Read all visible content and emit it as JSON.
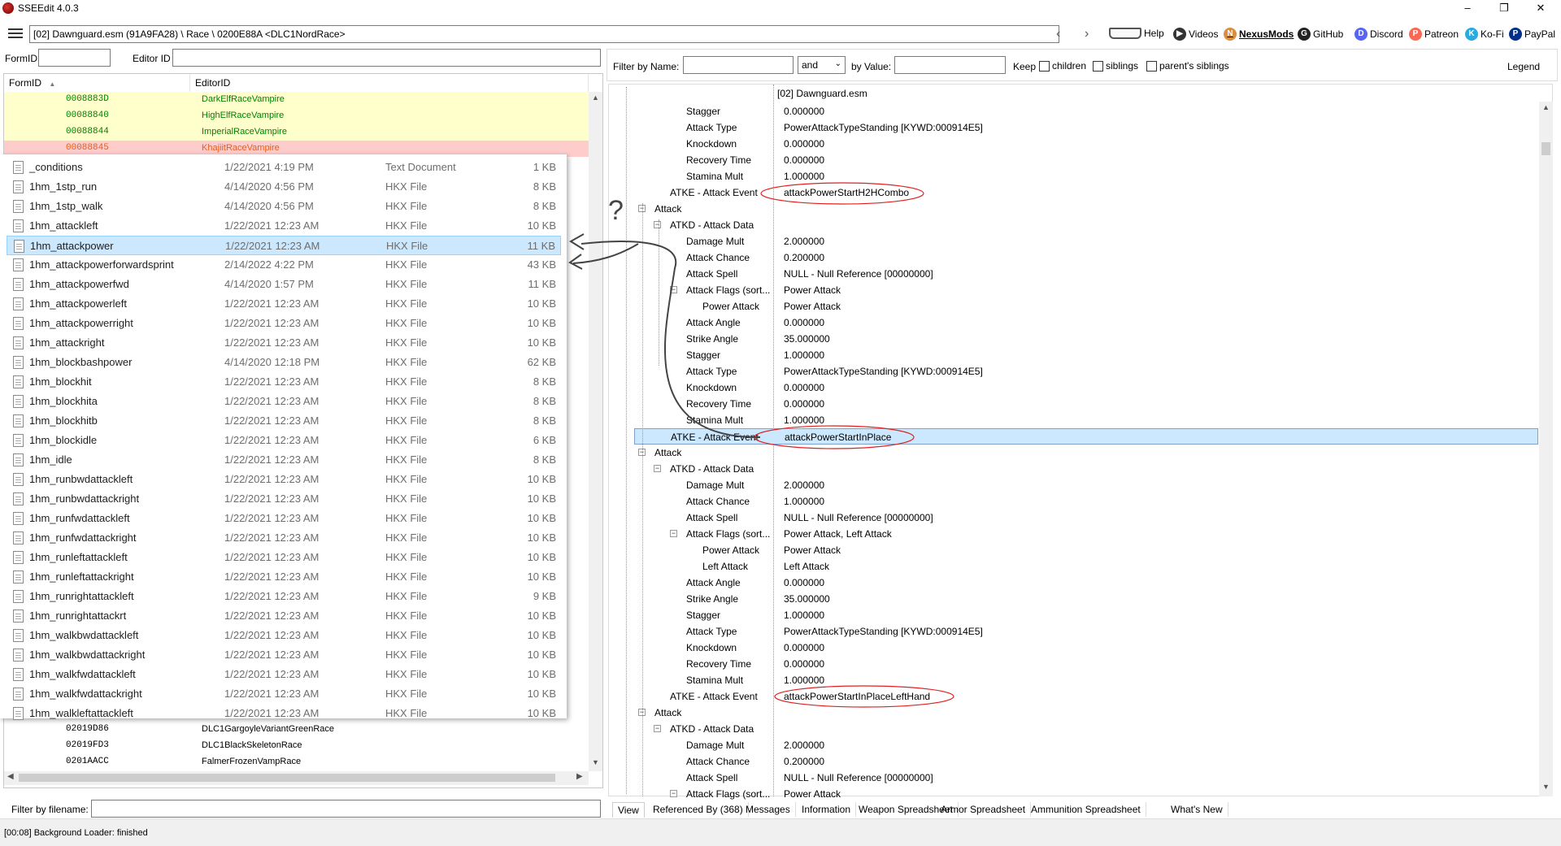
{
  "window": {
    "title": "SSEEdit 4.0.3",
    "minimize": "–",
    "maximize": "❐",
    "close": "✕"
  },
  "toolbar": {
    "path": "[02] Dawnguard.esm (91A9FA28) \\ Race \\ 0200E88A <DLC1NordRace>",
    "back": "‹",
    "forward": "›",
    "links": [
      "Help",
      "Videos",
      "NexusMods",
      "GitHub",
      "Discord",
      "Patreon",
      "Ko-Fi",
      "PayPal"
    ]
  },
  "left": {
    "formid_label": "FormID",
    "editorid_label": "Editor ID",
    "col_formid": "FormID",
    "col_editorid": "EditorID",
    "top_rows": [
      {
        "formid": "0008883D",
        "editorid": "DarkElfRaceVampire",
        "state": "yellow"
      },
      {
        "formid": "00088840",
        "editorid": "HighElfRaceVampire",
        "state": "yellow"
      },
      {
        "formid": "00088844",
        "editorid": "ImperialRaceVampire",
        "state": "yellow"
      },
      {
        "formid": "00088845",
        "editorid": "KhajiitRaceVampire",
        "state": "red"
      }
    ],
    "bottom_rows": [
      {
        "formid": "02019D86",
        "editorid": "DLC1GargoyleVariantGreenRace"
      },
      {
        "formid": "02019FD3",
        "editorid": "DLC1BlackSkeletonRace"
      },
      {
        "formid": "0201AACC",
        "editorid": "FalmerFrozenVampRace"
      }
    ],
    "filter_label": "Filter by filename:"
  },
  "explorer": {
    "files": [
      {
        "name": "_conditions",
        "date": "1/22/2021 4:19 PM",
        "type": "Text Document",
        "size": "1 KB"
      },
      {
        "name": "1hm_1stp_run",
        "date": "4/14/2020 4:56 PM",
        "type": "HKX File",
        "size": "8 KB"
      },
      {
        "name": "1hm_1stp_walk",
        "date": "4/14/2020 4:56 PM",
        "type": "HKX File",
        "size": "8 KB"
      },
      {
        "name": "1hm_attackleft",
        "date": "1/22/2021 12:23 AM",
        "type": "HKX File",
        "size": "10 KB"
      },
      {
        "name": "1hm_attackpower",
        "date": "1/22/2021 12:23 AM",
        "type": "HKX File",
        "size": "11 KB"
      },
      {
        "name": "1hm_attackpowerforwardsprint",
        "date": "2/14/2022 4:22 PM",
        "type": "HKX File",
        "size": "43 KB"
      },
      {
        "name": "1hm_attackpowerfwd",
        "date": "4/14/2020 1:57 PM",
        "type": "HKX File",
        "size": "11 KB"
      },
      {
        "name": "1hm_attackpowerleft",
        "date": "1/22/2021 12:23 AM",
        "type": "HKX File",
        "size": "10 KB"
      },
      {
        "name": "1hm_attackpowerright",
        "date": "1/22/2021 12:23 AM",
        "type": "HKX File",
        "size": "10 KB"
      },
      {
        "name": "1hm_attackright",
        "date": "1/22/2021 12:23 AM",
        "type": "HKX File",
        "size": "10 KB"
      },
      {
        "name": "1hm_blockbashpower",
        "date": "4/14/2020 12:18 PM",
        "type": "HKX File",
        "size": "62 KB"
      },
      {
        "name": "1hm_blockhit",
        "date": "1/22/2021 12:23 AM",
        "type": "HKX File",
        "size": "8 KB"
      },
      {
        "name": "1hm_blockhita",
        "date": "1/22/2021 12:23 AM",
        "type": "HKX File",
        "size": "8 KB"
      },
      {
        "name": "1hm_blockhitb",
        "date": "1/22/2021 12:23 AM",
        "type": "HKX File",
        "size": "8 KB"
      },
      {
        "name": "1hm_blockidle",
        "date": "1/22/2021 12:23 AM",
        "type": "HKX File",
        "size": "6 KB"
      },
      {
        "name": "1hm_idle",
        "date": "1/22/2021 12:23 AM",
        "type": "HKX File",
        "size": "8 KB"
      },
      {
        "name": "1hm_runbwdattackleft",
        "date": "1/22/2021 12:23 AM",
        "type": "HKX File",
        "size": "10 KB"
      },
      {
        "name": "1hm_runbwdattackright",
        "date": "1/22/2021 12:23 AM",
        "type": "HKX File",
        "size": "10 KB"
      },
      {
        "name": "1hm_runfwdattackleft",
        "date": "1/22/2021 12:23 AM",
        "type": "HKX File",
        "size": "10 KB"
      },
      {
        "name": "1hm_runfwdattackright",
        "date": "1/22/2021 12:23 AM",
        "type": "HKX File",
        "size": "10 KB"
      },
      {
        "name": "1hm_runleftattackleft",
        "date": "1/22/2021 12:23 AM",
        "type": "HKX File",
        "size": "10 KB"
      },
      {
        "name": "1hm_runleftattackright",
        "date": "1/22/2021 12:23 AM",
        "type": "HKX File",
        "size": "10 KB"
      },
      {
        "name": "1hm_runrightattackleft",
        "date": "1/22/2021 12:23 AM",
        "type": "HKX File",
        "size": "9 KB"
      },
      {
        "name": "1hm_runrightattackrt",
        "date": "1/22/2021 12:23 AM",
        "type": "HKX File",
        "size": "10 KB"
      },
      {
        "name": "1hm_walkbwdattackleft",
        "date": "1/22/2021 12:23 AM",
        "type": "HKX File",
        "size": "10 KB"
      },
      {
        "name": "1hm_walkbwdattackright",
        "date": "1/22/2021 12:23 AM",
        "type": "HKX File",
        "size": "10 KB"
      },
      {
        "name": "1hm_walkfwdattackleft",
        "date": "1/22/2021 12:23 AM",
        "type": "HKX File",
        "size": "10 KB"
      },
      {
        "name": "1hm_walkfwdattackright",
        "date": "1/22/2021 12:23 AM",
        "type": "HKX File",
        "size": "10 KB"
      },
      {
        "name": "1hm_walkleftattackleft",
        "date": "1/22/2021 12:23 AM",
        "type": "HKX File",
        "size": "10 KB"
      }
    ],
    "selected": 4
  },
  "annotation": {
    "question": "?"
  },
  "right": {
    "filter_name_label": "Filter by Name:",
    "and_select": "and",
    "by_value_label": "by Value:",
    "keep_label": "Keep",
    "children": "children",
    "siblings": "siblings",
    "parents_siblings": "parent's siblings",
    "legend": "Legend",
    "column_header": "[02] Dawnguard.esm",
    "rows": [
      {
        "label": "Stagger",
        "value": "0.000000",
        "indent": 3
      },
      {
        "label": "Attack Type",
        "value": "PowerAttackTypeStanding [KYWD:000914E5]",
        "indent": 3
      },
      {
        "label": "Knockdown",
        "value": "0.000000",
        "indent": 3
      },
      {
        "label": "Recovery Time",
        "value": "0.000000",
        "indent": 3
      },
      {
        "label": "Stamina Mult",
        "value": "1.000000",
        "indent": 3
      },
      {
        "label": "ATKE - Attack Event",
        "value": "attackPowerStartH2HCombo",
        "indent": 2,
        "circle": true
      },
      {
        "label": "Attack",
        "value": "",
        "indent": 1,
        "expander": true
      },
      {
        "label": "ATKD - Attack Data",
        "value": "",
        "indent": 2,
        "expander": true
      },
      {
        "label": "Damage Mult",
        "value": "2.000000",
        "indent": 3
      },
      {
        "label": "Attack Chance",
        "value": "0.200000",
        "indent": 3
      },
      {
        "label": "Attack Spell",
        "value": "NULL - Null Reference [00000000]",
        "indent": 3
      },
      {
        "label": "Attack Flags (sort...",
        "value": "Power Attack",
        "indent": 3,
        "expander": true
      },
      {
        "label": "Power Attack",
        "value": "Power Attack",
        "indent": 4
      },
      {
        "label": "Attack Angle",
        "value": "0.000000",
        "indent": 3
      },
      {
        "label": "Strike Angle",
        "value": "35.000000",
        "indent": 3
      },
      {
        "label": "Stagger",
        "value": "1.000000",
        "indent": 3
      },
      {
        "label": "Attack Type",
        "value": "PowerAttackTypeStanding [KYWD:000914E5]",
        "indent": 3
      },
      {
        "label": "Knockdown",
        "value": "0.000000",
        "indent": 3
      },
      {
        "label": "Recovery Time",
        "value": "0.000000",
        "indent": 3
      },
      {
        "label": "Stamina Mult",
        "value": "1.000000",
        "indent": 3
      },
      {
        "label": "ATKE - Attack Event",
        "value": "attackPowerStartInPlace",
        "indent": 2,
        "circle": true,
        "selected": true
      },
      {
        "label": "Attack",
        "value": "",
        "indent": 1,
        "expander": true
      },
      {
        "label": "ATKD - Attack Data",
        "value": "",
        "indent": 2,
        "expander": true
      },
      {
        "label": "Damage Mult",
        "value": "2.000000",
        "indent": 3
      },
      {
        "label": "Attack Chance",
        "value": "1.000000",
        "indent": 3
      },
      {
        "label": "Attack Spell",
        "value": "NULL - Null Reference [00000000]",
        "indent": 3
      },
      {
        "label": "Attack Flags (sort...",
        "value": "Power Attack, Left Attack",
        "indent": 3,
        "expander": true
      },
      {
        "label": "Power Attack",
        "value": "Power Attack",
        "indent": 4
      },
      {
        "label": "Left Attack",
        "value": "Left Attack",
        "indent": 4
      },
      {
        "label": "Attack Angle",
        "value": "0.000000",
        "indent": 3
      },
      {
        "label": "Strike Angle",
        "value": "35.000000",
        "indent": 3
      },
      {
        "label": "Stagger",
        "value": "1.000000",
        "indent": 3
      },
      {
        "label": "Attack Type",
        "value": "PowerAttackTypeStanding [KYWD:000914E5]",
        "indent": 3
      },
      {
        "label": "Knockdown",
        "value": "0.000000",
        "indent": 3
      },
      {
        "label": "Recovery Time",
        "value": "0.000000",
        "indent": 3
      },
      {
        "label": "Stamina Mult",
        "value": "1.000000",
        "indent": 3
      },
      {
        "label": "ATKE - Attack Event",
        "value": "attackPowerStartInPlaceLeftHand",
        "indent": 2,
        "circle": true
      },
      {
        "label": "Attack",
        "value": "",
        "indent": 1,
        "expander": true
      },
      {
        "label": "ATKD - Attack Data",
        "value": "",
        "indent": 2,
        "expander": true
      },
      {
        "label": "Damage Mult",
        "value": "2.000000",
        "indent": 3
      },
      {
        "label": "Attack Chance",
        "value": "0.200000",
        "indent": 3
      },
      {
        "label": "Attack Spell",
        "value": "NULL - Null Reference [00000000]",
        "indent": 3
      },
      {
        "label": "Attack Flags (sort...",
        "value": "Power Attack",
        "indent": 3,
        "expander": true
      }
    ],
    "tabs": [
      "View",
      "Referenced By (368)",
      "Messages",
      "Information",
      "Weapon Spreadsheet",
      "Armor Spreadsheet",
      "Ammunition Spreadsheet",
      "What's New"
    ]
  },
  "status": {
    "text": "[00:08] Background Loader: finished"
  },
  "colors": {
    "accent_selection": "#cce8ff",
    "annotation_red": "#e02020",
    "row_yellow": "#ffffcc",
    "row_red": "#ffcccc",
    "text_green": "#008000",
    "text_orange": "#e06020"
  }
}
